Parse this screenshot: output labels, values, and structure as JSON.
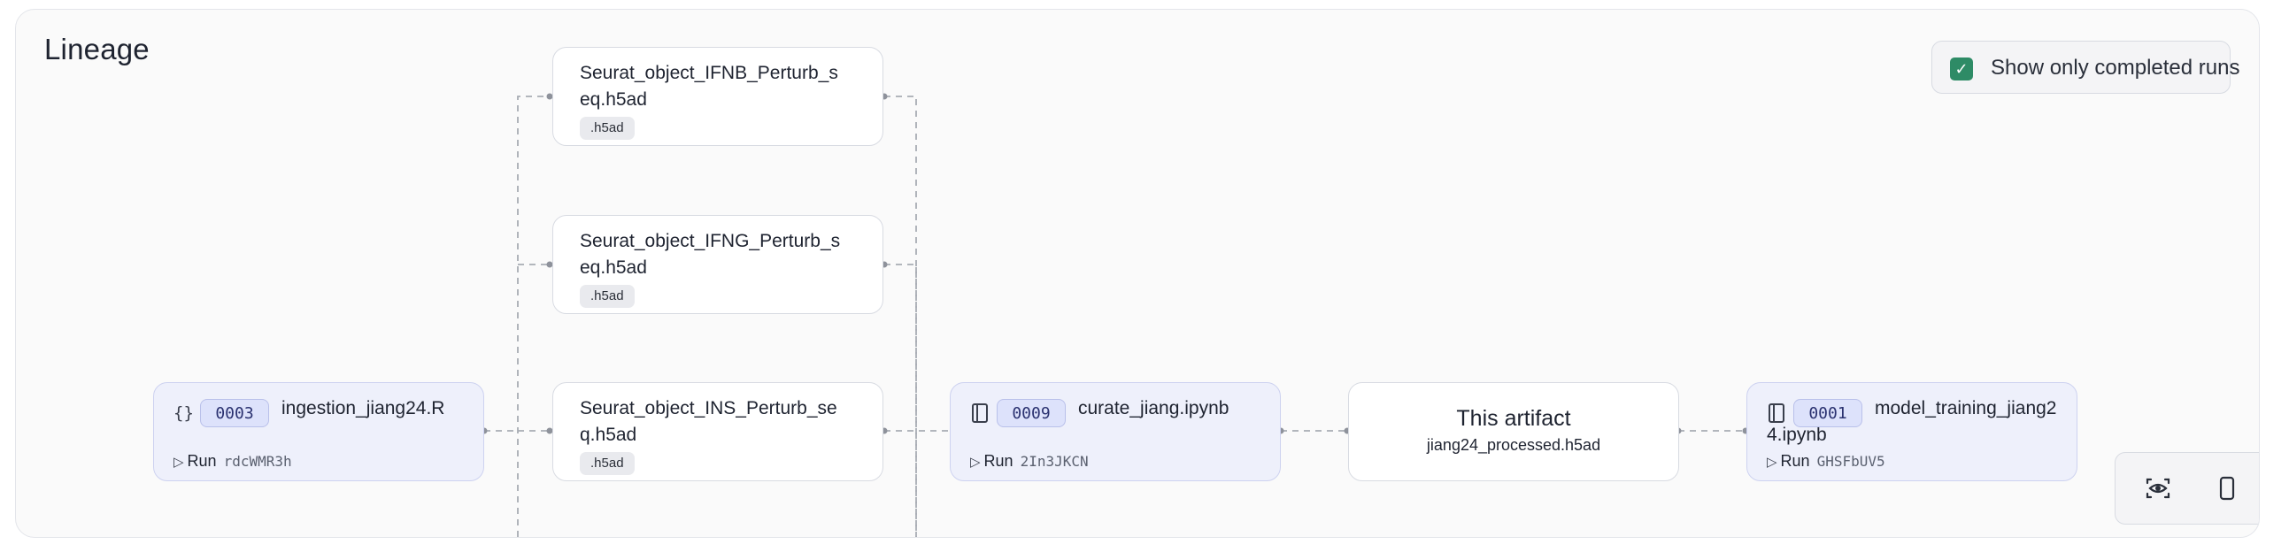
{
  "panel": {
    "title": "Lineage"
  },
  "filter": {
    "label": "Show only completed runs",
    "checked": true
  },
  "inputs": [
    {
      "name": "Seurat_object_IFNB_Perturb_seq.h5ad",
      "ext": ".h5ad"
    },
    {
      "name": "Seurat_object_IFNG_Perturb_seq.h5ad",
      "ext": ".h5ad"
    },
    {
      "name": "Seurat_object_INS_Perturb_seq.h5ad",
      "ext": ".h5ad"
    }
  ],
  "runs": {
    "ingestion": {
      "icon": "code-braces-icon",
      "number": "0003",
      "name": "ingestion_jiang24.R",
      "run_label": "Run",
      "run_id": "rdcWMR3h"
    },
    "curate": {
      "icon": "notebook-icon",
      "number": "0009",
      "name": "curate_jiang.ipynb",
      "run_label": "Run",
      "run_id": "2In3JKCN"
    },
    "training": {
      "icon": "notebook-icon",
      "number": "0001",
      "name": "model_training_jiang24.ipynb",
      "run_label": "Run",
      "run_id": "GHSFbUV5"
    }
  },
  "artifact": {
    "title": "This artifact",
    "filename": "jiang24_processed.h5ad"
  },
  "controls": {
    "view_icon": "eye-focus-icon",
    "mobile_icon": "phone-icon"
  }
}
